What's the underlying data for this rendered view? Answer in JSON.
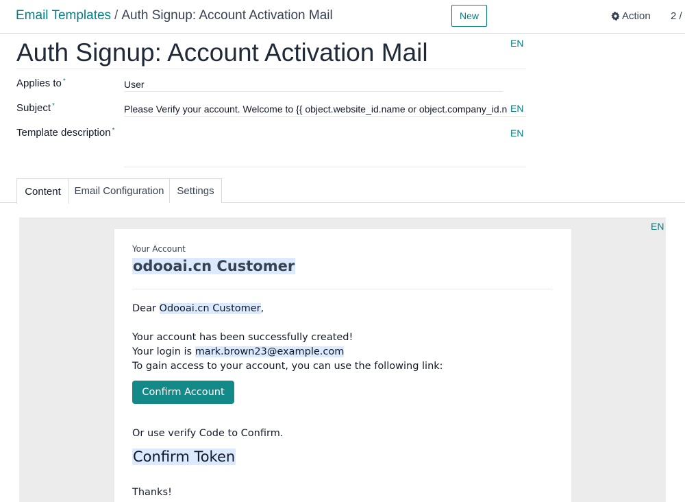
{
  "breadcrumb": {
    "parent": "Email Templates",
    "separator": "/",
    "current": "Auth Signup: Account Activation Mail"
  },
  "toolbar": {
    "new_label": "New",
    "action_label": "Action",
    "action_icon": "gear-icon",
    "pager": "2 /"
  },
  "record": {
    "title": "Auth Signup: Account Activation Mail",
    "title_lang": "EN"
  },
  "fields": {
    "applies_to": {
      "label": "Applies to",
      "required_mark": "*",
      "value": "User"
    },
    "subject": {
      "label": "Subject",
      "required_mark": "*",
      "value": "Please Verify your account. Welcome to {{ object.website_id.name or object.company_id.name }}",
      "lang": "EN"
    },
    "description": {
      "label": "Template description",
      "required_mark": "*",
      "value": "",
      "lang": "EN"
    }
  },
  "tabs": [
    {
      "label": "Content",
      "active": true
    },
    {
      "label": "Email Configuration",
      "active": false
    },
    {
      "label": "Settings",
      "active": false
    }
  ],
  "body": {
    "lang": "EN",
    "small_label": "Your Account",
    "heading": "odooai.cn Customer",
    "greeting_prefix": "Dear ",
    "greeting_name": "Odooai.cn Customer",
    "greeting_suffix": ",",
    "line1": "Your account has been successfully created!",
    "login_prefix": "Your login is ",
    "login_email": "mark.brown23@example.com",
    "line3": "To gain access to your account, you can use the following link:",
    "confirm_button": "Confirm Account",
    "verify_text": "Or use verify Code to Confirm.",
    "confirm_token": "Confirm Token",
    "thanks": "Thanks!"
  },
  "colors": {
    "brand": "#017e84",
    "button": "#148a88",
    "highlight": "#dbeafe",
    "editor_bg": "#ececec"
  }
}
